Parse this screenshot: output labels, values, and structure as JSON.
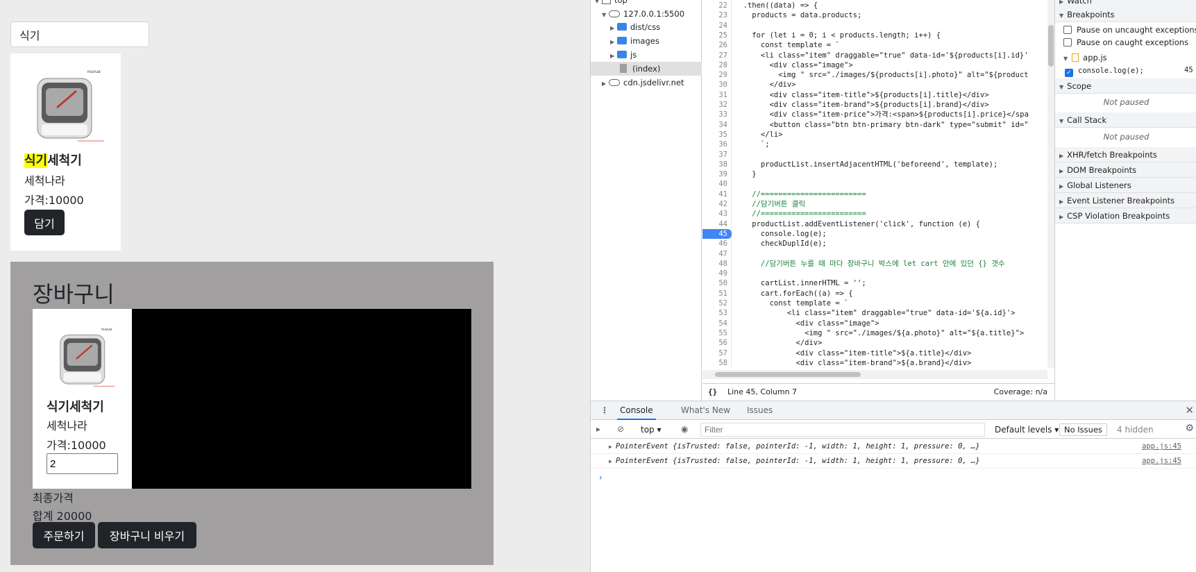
{
  "page": {
    "search_value": "식기",
    "product": {
      "title_highlight": "식기",
      "title_rest": "세척기",
      "brand": "세척나라",
      "price": "가격:10000",
      "add_button": "담기",
      "image_brand_text": "nuvua"
    },
    "cart": {
      "heading": "장바구니",
      "item_title": "식기세척기",
      "item_brand": "세척나라",
      "item_price": "가격:10000",
      "quantity": "2",
      "final_label": "최종가격",
      "total": "합계 20000",
      "order_button": "주문하기",
      "empty_button": "장바구니 비우기"
    }
  },
  "devtools": {
    "file_tree": [
      {
        "label": "top",
        "kind": "frame"
      },
      {
        "label": "127.0.0.1:5500",
        "kind": "cloud"
      },
      {
        "label": "dist/css",
        "kind": "folder"
      },
      {
        "label": "images",
        "kind": "folder"
      },
      {
        "label": "js",
        "kind": "folder"
      },
      {
        "label": "(index)",
        "kind": "file"
      },
      {
        "label": "cdn.jsdelivr.net",
        "kind": "cloud"
      }
    ],
    "code_lines": [
      {
        "n": "22",
        "text": "  .then((data) => {"
      },
      {
        "n": "23",
        "text": "    products = data.products;"
      },
      {
        "n": "24",
        "text": ""
      },
      {
        "n": "25",
        "text": "    for (let i = 0; i < products.length; i++) {"
      },
      {
        "n": "26",
        "text": "      const template = `"
      },
      {
        "n": "27",
        "text": "      <li class=\"item\" draggable=\"true\" data-id='${products[i].id}'"
      },
      {
        "n": "28",
        "text": "        <div class=\"image\">"
      },
      {
        "n": "29",
        "text": "          <img \" src=\"./images/${products[i].photo}\" alt=\"${product"
      },
      {
        "n": "30",
        "text": "        </div>"
      },
      {
        "n": "31",
        "text": "        <div class=\"item-title\">${products[i].title}</div>"
      },
      {
        "n": "32",
        "text": "        <div class=\"item-brand\">${products[i].brand}</div>"
      },
      {
        "n": "33",
        "text": "        <div class=\"item-price\">가격:<span>${products[i].price}</spa"
      },
      {
        "n": "34",
        "text": "        <button class=\"btn btn-primary btn-dark\" type=\"submit\" id=\""
      },
      {
        "n": "35",
        "text": "      </li>"
      },
      {
        "n": "36",
        "text": "      `;"
      },
      {
        "n": "37",
        "text": ""
      },
      {
        "n": "38",
        "text": "      productList.insertAdjacentHTML('beforeend', template);"
      },
      {
        "n": "39",
        "text": "    }"
      },
      {
        "n": "40",
        "text": ""
      },
      {
        "n": "41",
        "text": "    //========================"
      },
      {
        "n": "42",
        "text": "    //담기버튼 클릭"
      },
      {
        "n": "43",
        "text": "    //========================"
      },
      {
        "n": "44",
        "text": "    productList.addEventListener('click', function (e) {"
      },
      {
        "n": "45",
        "text": "      console.log(e);"
      },
      {
        "n": "46",
        "text": "      checkDuplId(e);"
      },
      {
        "n": "47",
        "text": ""
      },
      {
        "n": "48",
        "text": "      //담기버튼 누를 때 마다 장바구니 박스에 let cart 안에 있던 {} 갯수"
      },
      {
        "n": "49",
        "text": ""
      },
      {
        "n": "50",
        "text": "      cartList.innerHTML = '';"
      },
      {
        "n": "51",
        "text": "      cart.forEach((a) => {"
      },
      {
        "n": "52",
        "text": "        const template = `"
      },
      {
        "n": "53",
        "text": "            <li class=\"item\" draggable=\"true\" data-id='${a.id}'>"
      },
      {
        "n": "54",
        "text": "              <div class=\"image\">"
      },
      {
        "n": "55",
        "text": "                <img \" src=\"./images/${a.photo}\" alt=\"${a.title}\">"
      },
      {
        "n": "56",
        "text": "              </div>"
      },
      {
        "n": "57",
        "text": "              <div class=\"item-title\">${a.title}</div>"
      },
      {
        "n": "58",
        "text": "              <div class=\"item-brand\">${a.brand}</div>"
      }
    ],
    "status": {
      "braces": "{}",
      "position": "Line 45, Column 7",
      "coverage": "Coverage: n/a"
    },
    "sidebar": {
      "watch": "Watch",
      "breakpoints": "Breakpoints",
      "pause_uncaught": "Pause on uncaught exceptions",
      "pause_caught": "Pause on caught exceptions",
      "bp_file": "app.js",
      "bp_line_code": "console.log(e);",
      "bp_line_no": "45",
      "scope": "Scope",
      "scope_state": "Not paused",
      "call_stack": "Call Stack",
      "call_stack_state": "Not paused",
      "xhr": "XHR/fetch Breakpoints",
      "dom": "DOM Breakpoints",
      "global": "Global Listeners",
      "event": "Event Listener Breakpoints",
      "csp": "CSP Violation Breakpoints"
    },
    "console": {
      "tabs": [
        "Console",
        "What's New",
        "Issues"
      ],
      "context": "top",
      "filter_placeholder": "Filter",
      "levels": "Default levels",
      "no_issues": "No Issues",
      "hidden": "4 hidden",
      "logs": [
        {
          "text": "PointerEvent {isTrusted: false, pointerId: -1, width: 1, height: 1, pressure: 0, …}",
          "source": "app.js:45"
        },
        {
          "text": "PointerEvent {isTrusted: false, pointerId: -1, width: 1, height: 1, pressure: 0, …}",
          "source": "app.js:45"
        }
      ],
      "prompt": "›"
    }
  }
}
